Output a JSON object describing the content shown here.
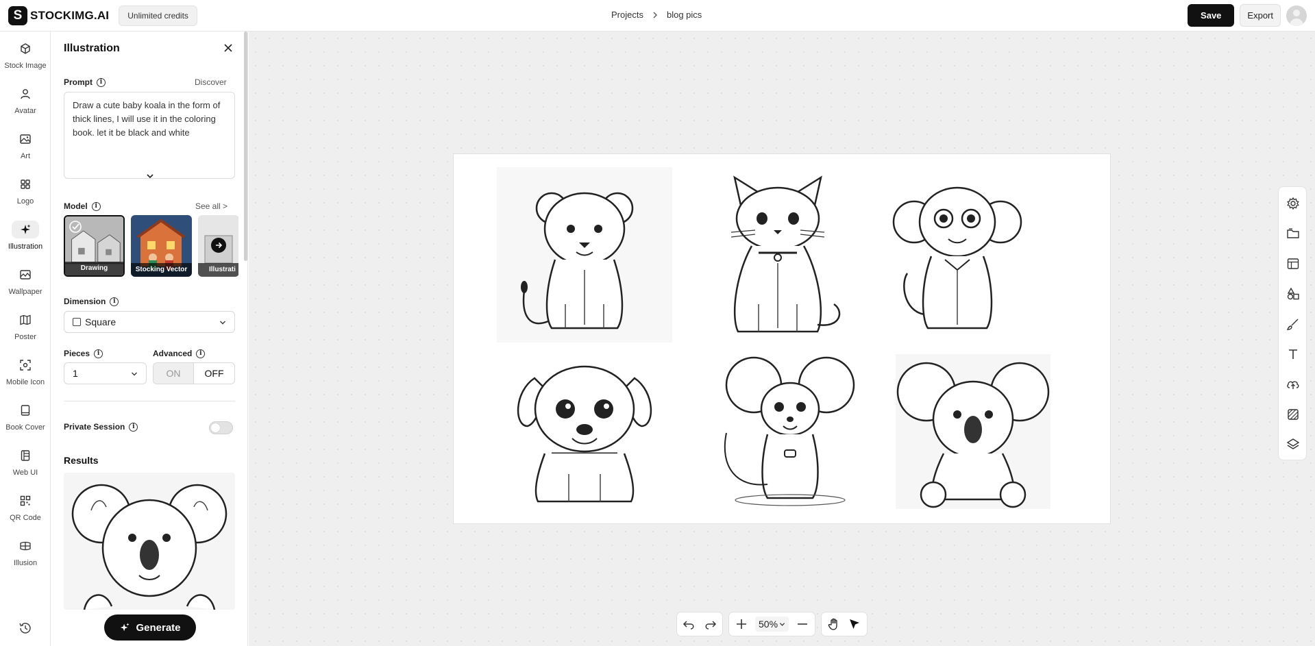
{
  "app": {
    "logo_text": "STOCKIMG.AI",
    "logo_mark": "S",
    "credits_badge": "Unlimited credits"
  },
  "breadcrumb": {
    "items": [
      "Projects",
      "blog pics"
    ]
  },
  "toolbar": {
    "save_label": "Save",
    "export_label": "Export"
  },
  "leftnav": {
    "items": [
      {
        "label": "Stock Image",
        "icon": "cube-icon"
      },
      {
        "label": "Avatar",
        "icon": "user-icon"
      },
      {
        "label": "Art",
        "icon": "image-icon"
      },
      {
        "label": "Logo",
        "icon": "grid-icon"
      },
      {
        "label": "Illustration",
        "icon": "sparkle-icon",
        "active": true
      },
      {
        "label": "Wallpaper",
        "icon": "wallpaper-icon"
      },
      {
        "label": "Poster",
        "icon": "map-icon"
      },
      {
        "label": "Mobile Icon",
        "icon": "app-icon"
      },
      {
        "label": "Book Cover",
        "icon": "book-icon"
      },
      {
        "label": "Web UI",
        "icon": "layout-icon"
      },
      {
        "label": "QR Code",
        "icon": "qr-icon"
      },
      {
        "label": "Illusion",
        "icon": "illusion-icon"
      }
    ],
    "history_icon": "history-icon"
  },
  "panel": {
    "title": "Illustration",
    "prompt_label": "Prompt",
    "discover_link": "Discover",
    "prompt_text": "Draw a cute baby koala in the form of thick lines, I will use it in the coloring book. let it be black and white",
    "model_label": "Model",
    "see_all_link": "See all >",
    "models": [
      {
        "name": "Drawing",
        "selected": true
      },
      {
        "name": "Stocking Vector",
        "selected": false
      },
      {
        "name": "Illustrati",
        "selected": false
      }
    ],
    "dimension_label": "Dimension",
    "dimension_value": "Square",
    "pieces_label": "Pieces",
    "pieces_value": "1",
    "advanced_label": "Advanced",
    "advanced_on": "ON",
    "advanced_off": "OFF",
    "private_session_label": "Private Session",
    "private_session_enabled": false,
    "results_label": "Results",
    "generate_label": "Generate"
  },
  "canvas": {
    "zoom_level": "50%",
    "images": [
      "lion cub",
      "kitten",
      "monkey",
      "puppy",
      "mouse",
      "koala"
    ]
  },
  "colors": {
    "primary": "#111111",
    "canvas_bg": "#efefef",
    "panel_border": "#e6e6e6"
  }
}
